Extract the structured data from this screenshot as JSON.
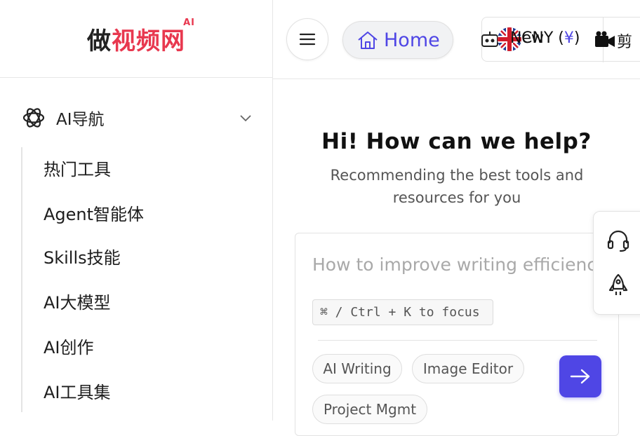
{
  "logo": {
    "text_dark": "做",
    "text_red": "视频网",
    "badge": "AI"
  },
  "nav": {
    "header_label": "AI导航",
    "items": [
      {
        "label": "热门工具"
      },
      {
        "label": "Agent智能体"
      },
      {
        "label": "Skills技能"
      },
      {
        "label": "AI大模型"
      },
      {
        "label": "AI创作"
      },
      {
        "label": "AI工具集"
      }
    ]
  },
  "topbar": {
    "home_label": "Home",
    "new_label": "New",
    "currency_prefix": "CNY (",
    "currency_symbol": "¥",
    "currency_suffix": ")",
    "cut_label": "剪"
  },
  "hero": {
    "title": "Hi! How can we help?",
    "subtitle": "Recommending the best tools and resources for you"
  },
  "search": {
    "placeholder": "How to improve writing efficiency",
    "shortcut": "⌘ / Ctrl + K to focus",
    "chips": [
      "AI Writing",
      "Image Editor",
      "Project Mgmt"
    ]
  },
  "colors": {
    "accent": "#4f46e5",
    "brand_red": "#e8384f"
  },
  "icons": [
    "menu-icon",
    "home-icon",
    "robot-icon",
    "uk-flag-icon",
    "camera-icon",
    "chevron-down-icon",
    "openai-icon",
    "arrow-right-icon",
    "headset-icon",
    "rocket-icon"
  ]
}
